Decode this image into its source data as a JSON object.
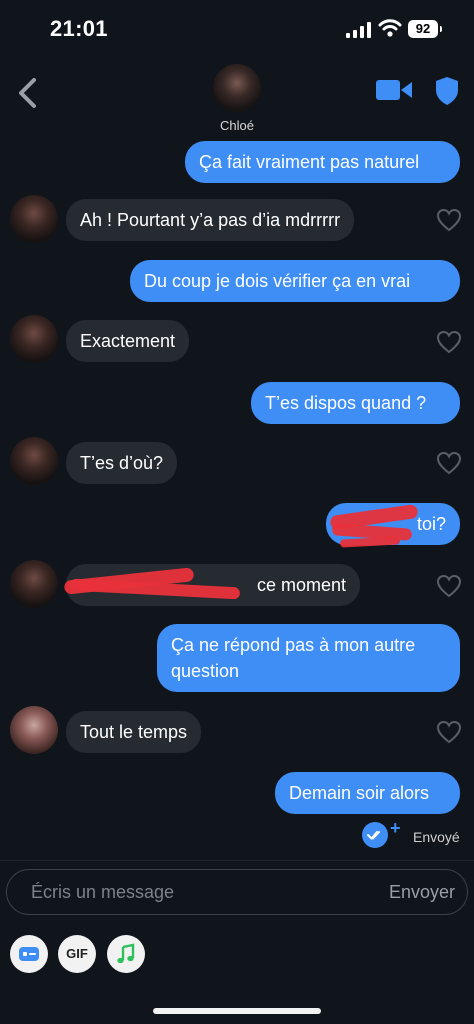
{
  "status_bar": {
    "time": "21:01",
    "battery": "92"
  },
  "header": {
    "contact_name": "Chloé"
  },
  "messages": [
    {
      "text": "Ça fait vraiment pas naturel"
    },
    {
      "text": "Ah ! Pourtant y’a pas d’ia mdrrrrr"
    },
    {
      "text": "Du coup je dois vérifier ça en vrai"
    },
    {
      "text": "Exactement"
    },
    {
      "text": "T’es dispos quand ?"
    },
    {
      "text": "T’es d’où?"
    },
    {
      "text": "toi?"
    },
    {
      "text": "ce moment"
    },
    {
      "text": "Ça ne répond pas à mon autre"
    },
    {
      "text": "question"
    },
    {
      "text": "Tout le temps"
    },
    {
      "text": "Demain soir alors"
    }
  ],
  "status": {
    "sent_label": "Envoyé"
  },
  "composer": {
    "placeholder": "Écris un message",
    "send_label": "Envoyer"
  },
  "toolbar": {
    "gif_label": "GIF"
  },
  "colors": {
    "accent": "#3e8ef5",
    "background": "#10141b",
    "incoming_bubble": "#262a31",
    "redaction": "#e8313a"
  }
}
